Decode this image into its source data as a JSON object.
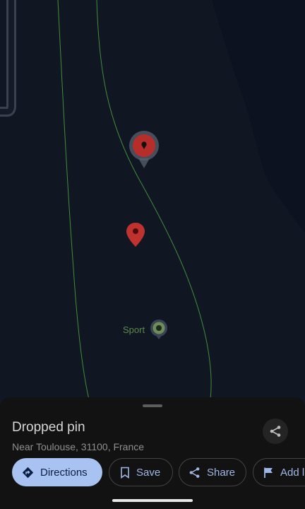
{
  "map": {
    "poi_label": "Sport",
    "colors": {
      "land": "#111722",
      "water": "#0c1220",
      "road_edge": "#3a4150",
      "road_fill": "#141a26",
      "boundary": "#3f8f3a",
      "pin": "#c0322f",
      "poi": "#6b8e5a"
    }
  },
  "place": {
    "title": "Dropped pin",
    "subtitle": "Near Toulouse, 31100, France"
  },
  "actions": {
    "directions": "Directions",
    "save": "Save",
    "share": "Share",
    "add_label": "Add la"
  },
  "icons": {
    "directions": "directions-icon",
    "save": "bookmark-icon",
    "share": "share-icon",
    "label": "flag-icon"
  }
}
